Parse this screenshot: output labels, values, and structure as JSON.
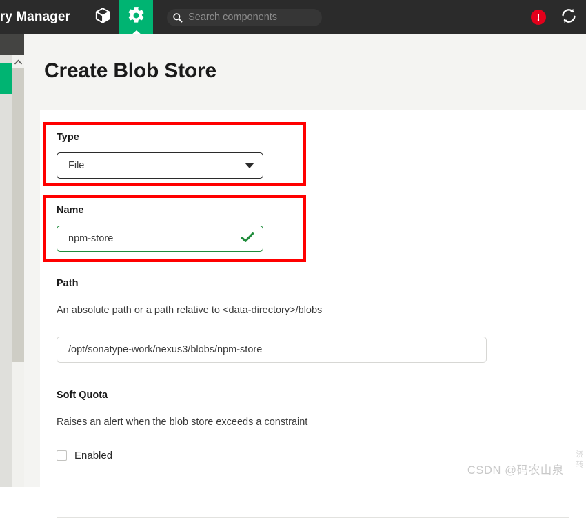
{
  "header": {
    "brand_title": "ory Manager",
    "nav_items": [
      {
        "name": "browse",
        "icon": "cube-icon",
        "active": false
      },
      {
        "name": "admin",
        "icon": "gear-icon",
        "active": true
      }
    ],
    "search": {
      "placeholder": "Search components",
      "value": "",
      "icon": "search-icon"
    },
    "alert_icon_glyph": "!",
    "alert_icon_name": "alert-circle-icon",
    "refresh_icon_name": "refresh-icon",
    "background_color": "#2b2b2b",
    "accent_color": "#00b472",
    "alert_color": "#e3001b"
  },
  "sidebar": {
    "active_item_color": "#00b472",
    "scrollbar": {
      "up_arrow_glyph": "▲"
    }
  },
  "main": {
    "page_title": "Create Blob Store",
    "fields": {
      "type": {
        "label": "Type",
        "value": "File",
        "caret_icon": "chevron-down-icon",
        "annotated": true
      },
      "name": {
        "label": "Name",
        "value": "npm-store",
        "valid_icon": "check-icon",
        "valid_color": "#1f8c3b",
        "annotated": true
      },
      "path": {
        "label": "Path",
        "description": "An absolute path or a path relative to <data-directory>/blobs",
        "value": "/opt/sonatype-work/nexus3/blobs/npm-store"
      },
      "soft_quota": {
        "label": "Soft Quota",
        "description": "Raises an alert when the blob store exceeds a constraint",
        "checkbox_label": "Enabled",
        "checked": false
      }
    },
    "annotation_color": "#ff0000"
  },
  "watermark": {
    "text": "CSDN @码农山泉",
    "side_text": "浇转"
  }
}
